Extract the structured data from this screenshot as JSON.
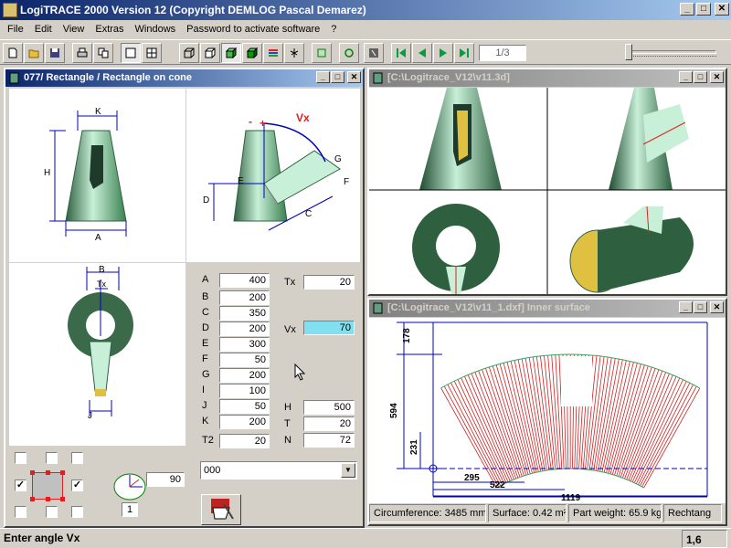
{
  "app": {
    "title": "LogiTRACE 2000  Version 12  (Copyright DEMLOG Pascal Demarez)"
  },
  "window_buttons": {
    "minimize": "_",
    "maximize": "□",
    "close": "✕"
  },
  "menu": [
    "File",
    "Edit",
    "View",
    "Extras",
    "Windows",
    "Password to activate software",
    "?"
  ],
  "toolbar": {
    "page": "1/3",
    "zoom_level": 0
  },
  "win_params": {
    "title": "077/ Rectangle / Rectangle on cone",
    "diagram_labels": {
      "K": "K",
      "H": "H",
      "A": "A",
      "D": "D",
      "E": "E",
      "C": "C",
      "G": "G",
      "F": "F",
      "Vx": "Vx",
      "minus": "-",
      "plus": "+",
      "B": "B",
      "Tx": "Tx",
      "J": "J"
    },
    "fields_left": [
      {
        "label": "A",
        "value": "400"
      },
      {
        "label": "B",
        "value": "200"
      },
      {
        "label": "C",
        "value": "350"
      },
      {
        "label": "D",
        "value": "200"
      },
      {
        "label": "E",
        "value": "300"
      },
      {
        "label": "F",
        "value": "50"
      },
      {
        "label": "G",
        "value": "200"
      },
      {
        "label": "I",
        "value": "100"
      },
      {
        "label": "J",
        "value": "50"
      },
      {
        "label": "K",
        "value": "200"
      },
      {
        "label": "T2",
        "value": "20"
      }
    ],
    "fields_right": [
      {
        "label": "Tx",
        "value": "20"
      },
      {
        "label": "Vx",
        "value": "70"
      },
      {
        "label": "H",
        "value": "500"
      },
      {
        "label": "T",
        "value": "20"
      },
      {
        "label": "N",
        "value": "72"
      }
    ],
    "angle_value": "90",
    "count_value": "1",
    "combo_value": "000",
    "checkmark": "✓"
  },
  "win_3d": {
    "title": "[C:\\Logitrace_V12\\v11.3d]"
  },
  "win_dxf": {
    "title": "[C:\\Logitrace_V12\\v11_1.dxf]  Inner surface",
    "dims": {
      "d178": "178",
      "d594": "594",
      "d231": "231",
      "d295": "295",
      "d522": "522",
      "d1119": "1119"
    }
  },
  "status": {
    "circumference": "Circumference: 3485 mm",
    "surface": "Surface: 0.42 m²",
    "weight": "Part weight: 65.9 kg",
    "type": "Rechtang"
  },
  "bottom": {
    "message": "Enter angle Vx",
    "position": "1,6"
  },
  "colors": {
    "cone": "#7fd8a8",
    "dark": "#2e6040",
    "dim": "#0000c0",
    "dev_line": "#d02020",
    "active_title": "#0a246a",
    "highlight": "#80e0f0"
  }
}
